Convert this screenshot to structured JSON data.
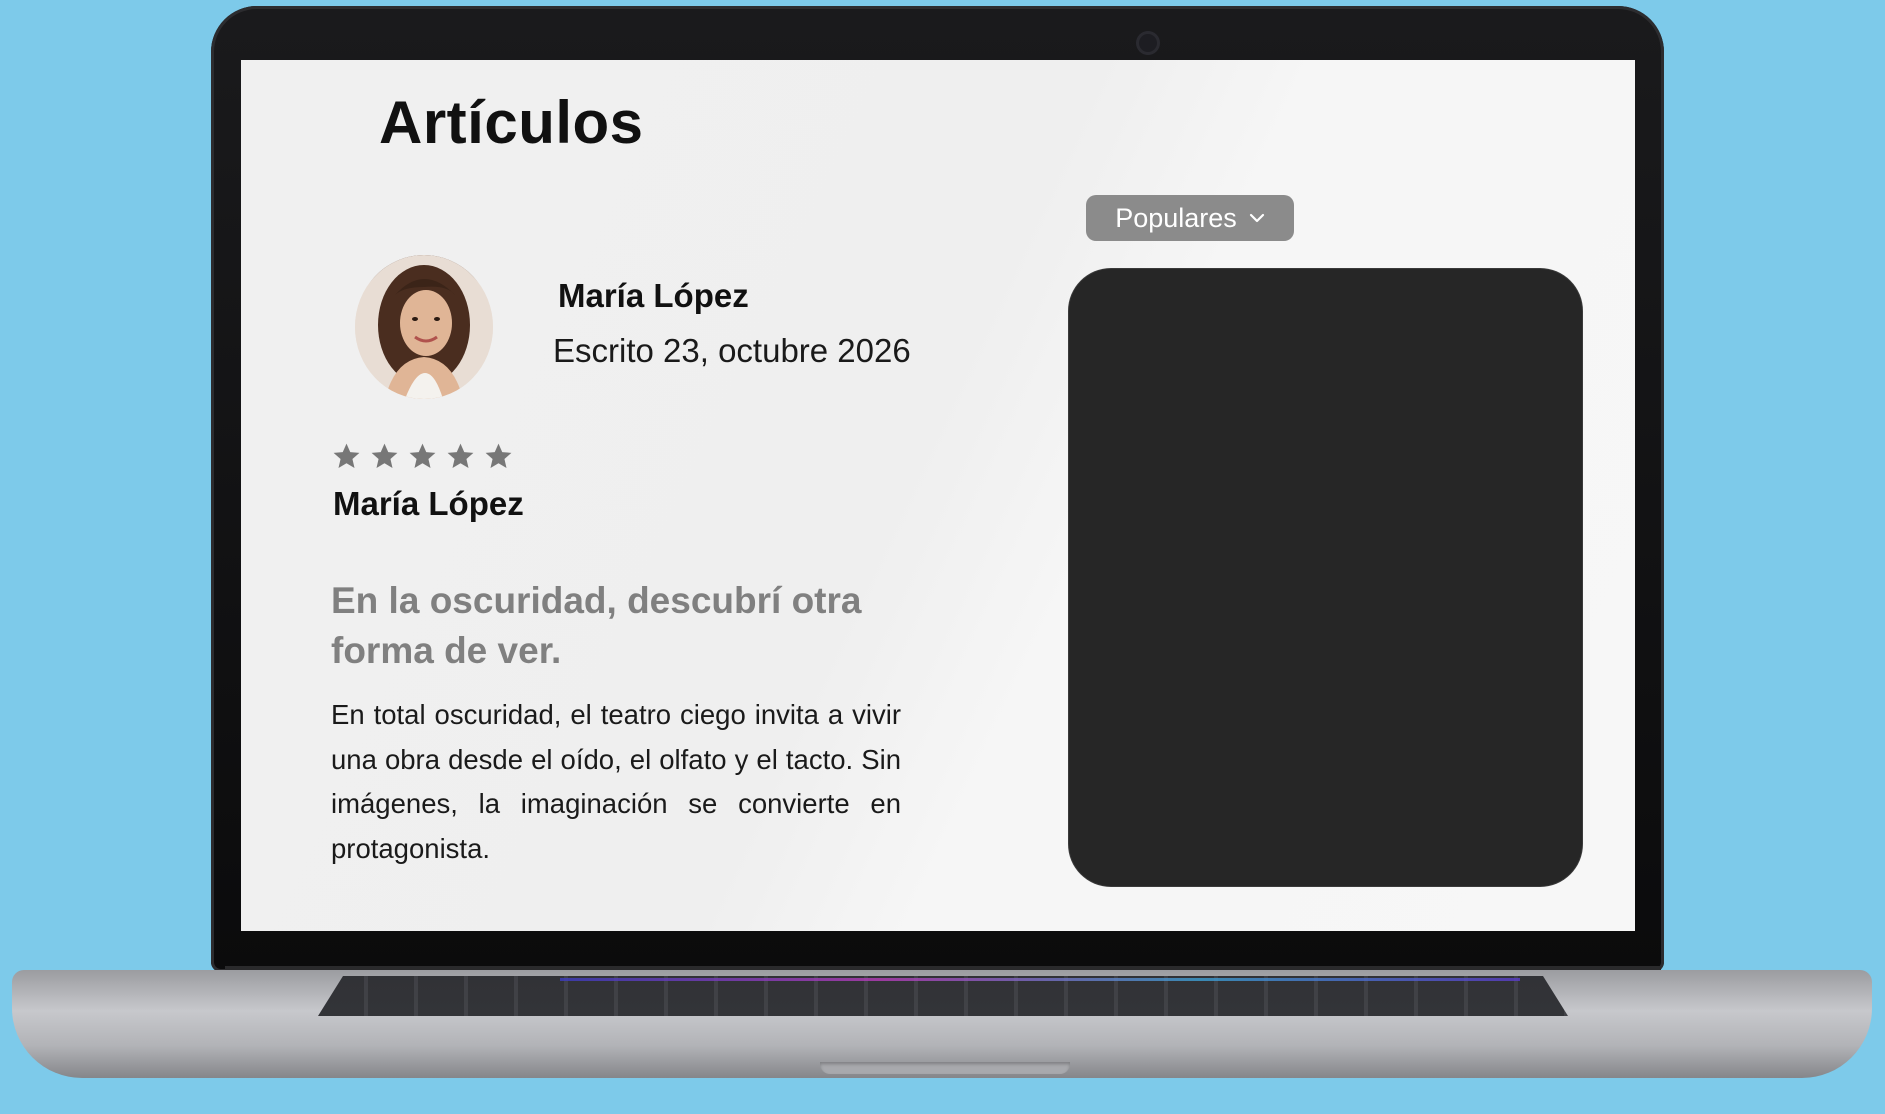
{
  "page": {
    "title": "Artículos"
  },
  "author": {
    "name": "María López",
    "date": "Escrito 23, octubre 2026"
  },
  "review": {
    "rating": 5,
    "max_rating": 5,
    "reviewer_name": "María López"
  },
  "article": {
    "headline": "En la oscuridad, descubrí otra forma de ver.",
    "body": "En total oscuridad, el teatro ciego invita a vivir una obra desde el oído, el olfato y el tacto. Sin imágenes, la imaginación se convierte en protagonista."
  },
  "sort": {
    "label": "Populares",
    "icon": "chevron-down-icon"
  },
  "colors": {
    "background": "#7dcaea",
    "dropdown": "#8b8b8b",
    "star": "#777777",
    "headline": "#808080",
    "media_panel": "#262626"
  },
  "icons": {
    "rating": "star-icon",
    "avatar": "avatar-photo"
  }
}
